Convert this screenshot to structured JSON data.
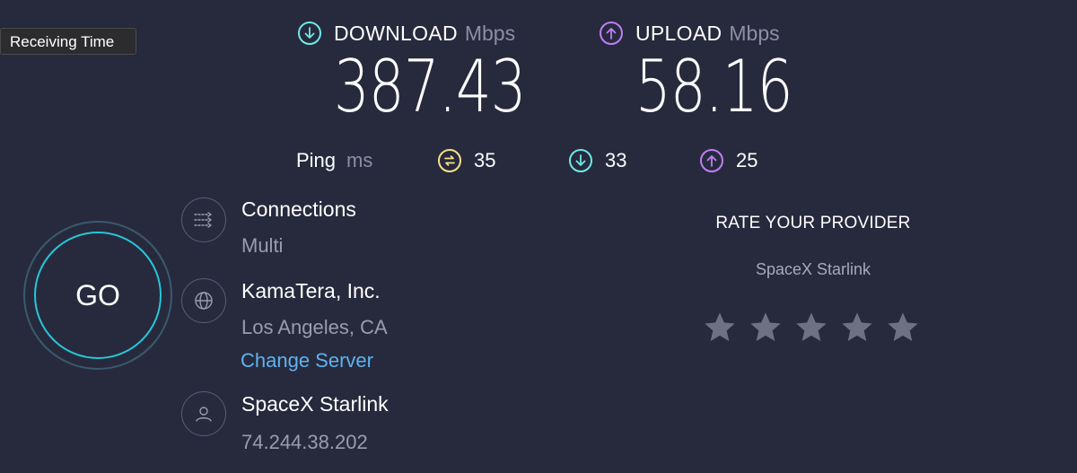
{
  "tooltip": {
    "text": "Receiving Time"
  },
  "download": {
    "label": "DOWNLOAD",
    "unit": "Mbps",
    "value": "387.43",
    "icon": "arrow-down-circle-icon",
    "color": "#6fe8e8"
  },
  "upload": {
    "label": "UPLOAD",
    "unit": "Mbps",
    "value": "58.16",
    "icon": "arrow-up-circle-icon",
    "color": "#bf7ef7"
  },
  "ping": {
    "label": "Ping",
    "unit": "ms",
    "idle": {
      "value": "35",
      "icon": "idle-latency-icon",
      "color": "#f7e08a"
    },
    "download": {
      "value": "33",
      "icon": "arrow-down-circle-icon",
      "color": "#6fe8e8"
    },
    "upload": {
      "value": "25",
      "icon": "arrow-up-circle-icon",
      "color": "#bf7ef7"
    }
  },
  "go_button": {
    "label": "GO"
  },
  "connections": {
    "title": "Connections",
    "value": "Multi",
    "icon": "connections-icon"
  },
  "server": {
    "name": "KamaTera, Inc.",
    "location": "Los Angeles, CA",
    "change_label": "Change Server",
    "icon": "globe-icon"
  },
  "provider": {
    "name": "SpaceX Starlink",
    "ip": "74.244.38.202",
    "icon": "user-icon"
  },
  "rating": {
    "title": "RATE YOUR PROVIDER",
    "provider": "SpaceX Starlink",
    "stars_total": 5,
    "stars_selected": 0
  }
}
